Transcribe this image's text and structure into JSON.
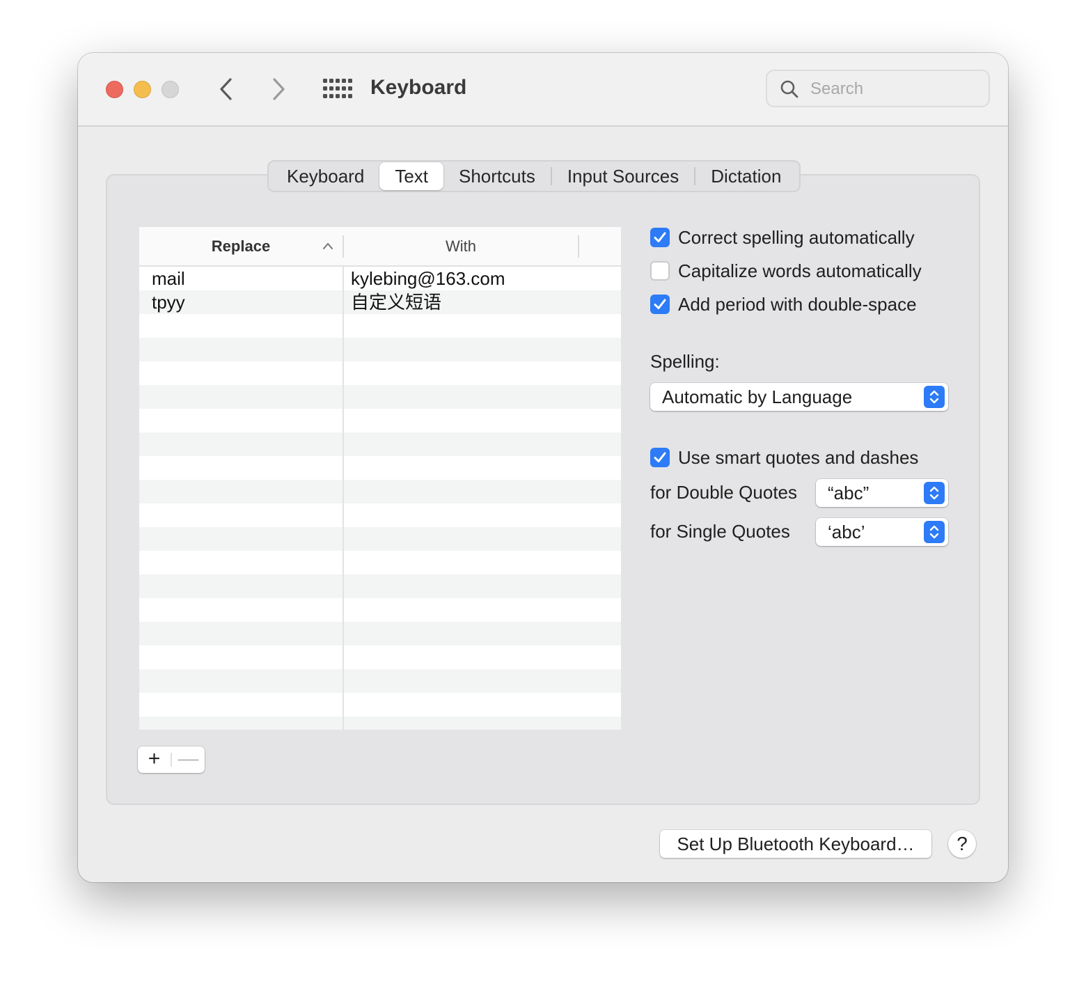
{
  "window": {
    "title": "Keyboard"
  },
  "search": {
    "placeholder": "Search",
    "value": ""
  },
  "tabs": [
    {
      "label": "Keyboard"
    },
    {
      "label": "Text",
      "selected": true
    },
    {
      "label": "Shortcuts"
    },
    {
      "label": "Input Sources"
    },
    {
      "label": "Dictation"
    }
  ],
  "table": {
    "columns": [
      {
        "label": "Replace",
        "sorted": "ascending"
      },
      {
        "label": "With"
      }
    ],
    "rows": [
      {
        "replace": "mail",
        "with": "kylebing@163.com"
      },
      {
        "replace": "tpyy",
        "with": "自定义短语"
      }
    ],
    "add_label": "+",
    "remove_label": "—"
  },
  "options": {
    "correct_spelling": {
      "label": "Correct spelling automatically",
      "checked": true
    },
    "capitalize_words": {
      "label": "Capitalize words automatically",
      "checked": false
    },
    "add_period": {
      "label": "Add period with double-space",
      "checked": true
    },
    "smart_quotes": {
      "label": "Use smart quotes and dashes",
      "checked": true
    }
  },
  "spelling": {
    "label": "Spelling:",
    "value": "Automatic by Language"
  },
  "double_quotes": {
    "label": "for Double Quotes",
    "value": "“abc”"
  },
  "single_quotes": {
    "label": "for Single Quotes",
    "value": "‘abc’"
  },
  "footer": {
    "bluetooth_label": "Set Up Bluetooth Keyboard…",
    "help_label": "?"
  },
  "colors": {
    "accent": "#2d7bf6",
    "close": "#ec6a5e",
    "minimize": "#f4be4f",
    "zoom": "#d6d6d6"
  }
}
